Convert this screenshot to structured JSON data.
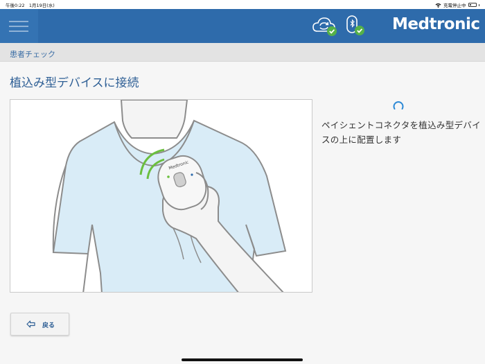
{
  "status_bar": {
    "time": "午後0:22",
    "date": "1月19日(水)",
    "charging": "充電停止中"
  },
  "header": {
    "brand": "Medtronic",
    "icons": [
      "menu-icon",
      "cloud-sync-icon",
      "bluetooth-connector-icon"
    ]
  },
  "breadcrumb": {
    "label": "患者チェック"
  },
  "main": {
    "title": "植込み型デバイスに接続",
    "instruction": "ペイシェントコネクタを植込み型デバイスの上に配置します"
  },
  "footer": {
    "back_label": "戻る"
  },
  "colors": {
    "header": "#2e6bab",
    "accent": "#2e5f95",
    "check_green": "#55b148",
    "spinner": "#2e8ad6"
  }
}
